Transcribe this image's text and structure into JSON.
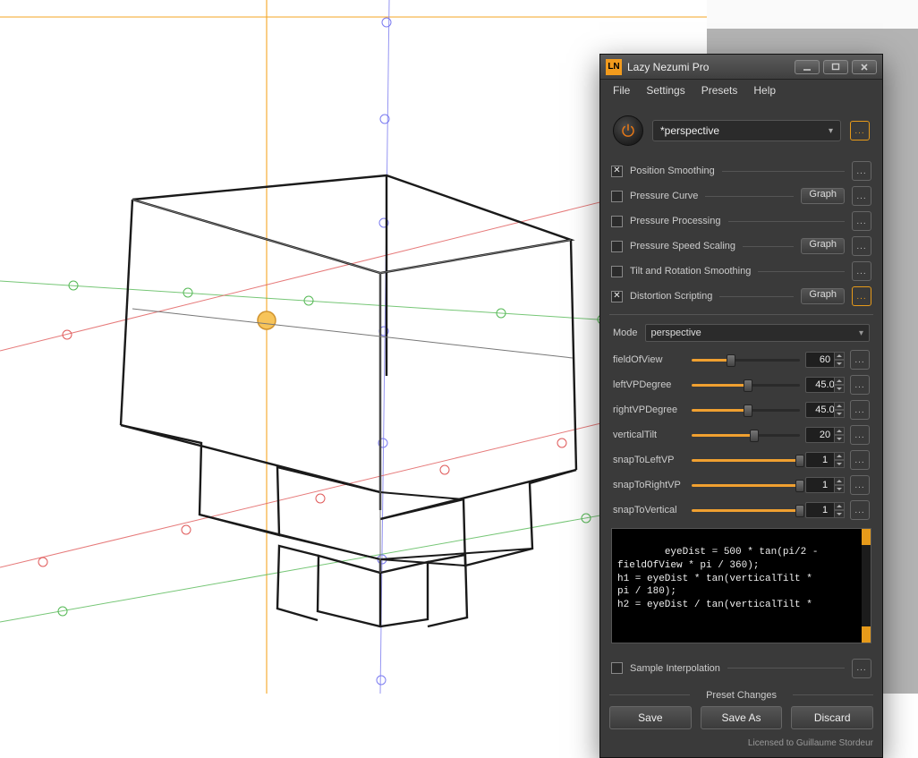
{
  "title": "Lazy Nezumi Pro",
  "menu": [
    "File",
    "Settings",
    "Presets",
    "Help"
  ],
  "preset_selector": "*perspective",
  "sections": {
    "position_smoothing": {
      "label": "Position Smoothing",
      "checked": true,
      "graph": false,
      "ell": true
    },
    "pressure_curve": {
      "label": "Pressure Curve",
      "checked": false,
      "graph": true,
      "ell": true
    },
    "pressure_processing": {
      "label": "Pressure Processing",
      "checked": false,
      "graph": false,
      "ell": true
    },
    "pressure_speed_scaling": {
      "label": "Pressure Speed Scaling",
      "checked": false,
      "graph": true,
      "ell": true
    },
    "tilt_rotation_smoothing": {
      "label": "Tilt and Rotation Smoothing",
      "checked": false,
      "graph": false,
      "ell": true
    },
    "distortion_scripting": {
      "label": "Distortion Scripting",
      "checked": true,
      "graph": true,
      "ell": true,
      "ell_orange": true
    }
  },
  "mode_label": "Mode",
  "mode_value": "perspective",
  "params": [
    {
      "key": "fieldOfView",
      "label": "fieldOfView",
      "value": "60",
      "pct": 36
    },
    {
      "key": "leftVPDegree",
      "label": "leftVPDegree",
      "value": "45.0",
      "pct": 52
    },
    {
      "key": "rightVPDegree",
      "label": "rightVPDegree",
      "value": "45.0",
      "pct": 52
    },
    {
      "key": "verticalTilt",
      "label": "verticalTilt",
      "value": "20",
      "pct": 58
    },
    {
      "key": "snapToLeftVP",
      "label": "snapToLeftVP",
      "value": "1",
      "pct": 100
    },
    {
      "key": "snapToRightVP",
      "label": "snapToRightVP",
      "value": "1",
      "pct": 100
    },
    {
      "key": "snapToVertical",
      "label": "snapToVertical",
      "value": "1",
      "pct": 100
    }
  ],
  "code": "eyeDist = 500 * tan(pi/2 -\nfieldOfView * pi / 360);\nh1 = eyeDist * tan(verticalTilt *\npi / 180);\nh2 = eyeDist / tan(verticalTilt *",
  "sample_interpolation": {
    "label": "Sample Interpolation",
    "checked": false
  },
  "preset_changes_label": "Preset Changes",
  "btn_save": "Save",
  "btn_save_as": "Save As",
  "btn_discard": "Discard",
  "graph_btn_label": "Graph",
  "license": "Licensed to Guillaume Stordeur"
}
